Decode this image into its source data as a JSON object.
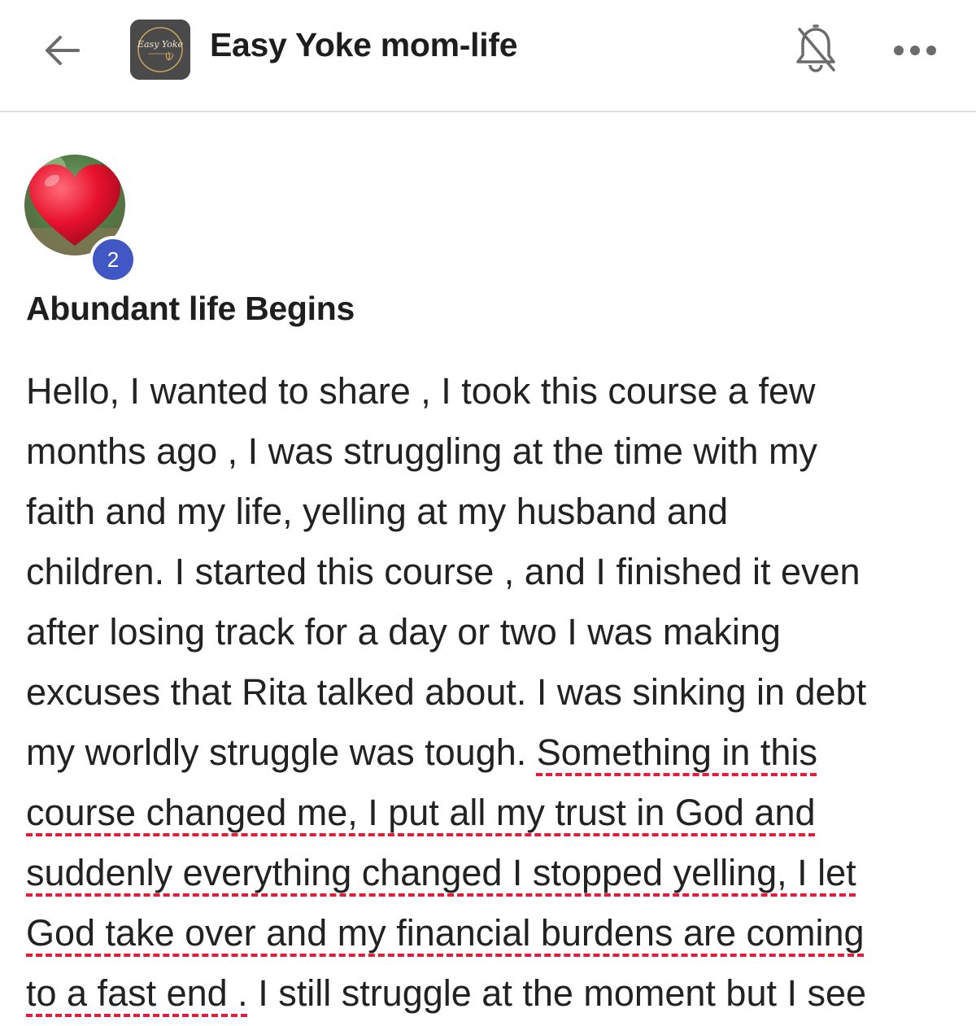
{
  "header": {
    "back_icon": "arrow-left-icon",
    "group_logo_text": "Easy Yoke",
    "title": "Easy Yoke mom-life",
    "bell_icon": "bell-off-icon",
    "more_icon": "more-horizontal-icon"
  },
  "post": {
    "avatar_icon": "heart-icon",
    "reaction_count": "2",
    "title": "Abundant life Begins",
    "lines": [
      {
        "plain": "Hello, I wanted to share , I took this course a few",
        "highlight": "",
        "after": ""
      },
      {
        "plain": "months ago , I was struggling at the time with my",
        "highlight": "",
        "after": ""
      },
      {
        "plain": "faith and my life, yelling at my husband and",
        "highlight": "",
        "after": ""
      },
      {
        "plain": "children. I started this course , and I finished it even",
        "highlight": "",
        "after": ""
      },
      {
        "plain": "after losing track for a day or two I was making",
        "highlight": "",
        "after": ""
      },
      {
        "plain": "excuses that Rita talked about. I was sinking in debt",
        "highlight": "",
        "after": ""
      },
      {
        "plain": "my worldly struggle was tough. ",
        "highlight": "Something in this",
        "after": ""
      },
      {
        "plain": "",
        "highlight": "course changed me, I put all my trust in God and",
        "after": ""
      },
      {
        "plain": "",
        "highlight": "suddenly everything changed I stopped yelling, I let",
        "after": ""
      },
      {
        "plain": "",
        "highlight": "God take over and my financial burdens are coming",
        "after": ""
      },
      {
        "plain": "",
        "highlight": "to a fast end .",
        "after": " I still struggle at the moment but I see"
      }
    ]
  },
  "colors": {
    "badge": "#4158c4",
    "highlight_underline": "#e11d3c",
    "heart": "#e8112d"
  }
}
